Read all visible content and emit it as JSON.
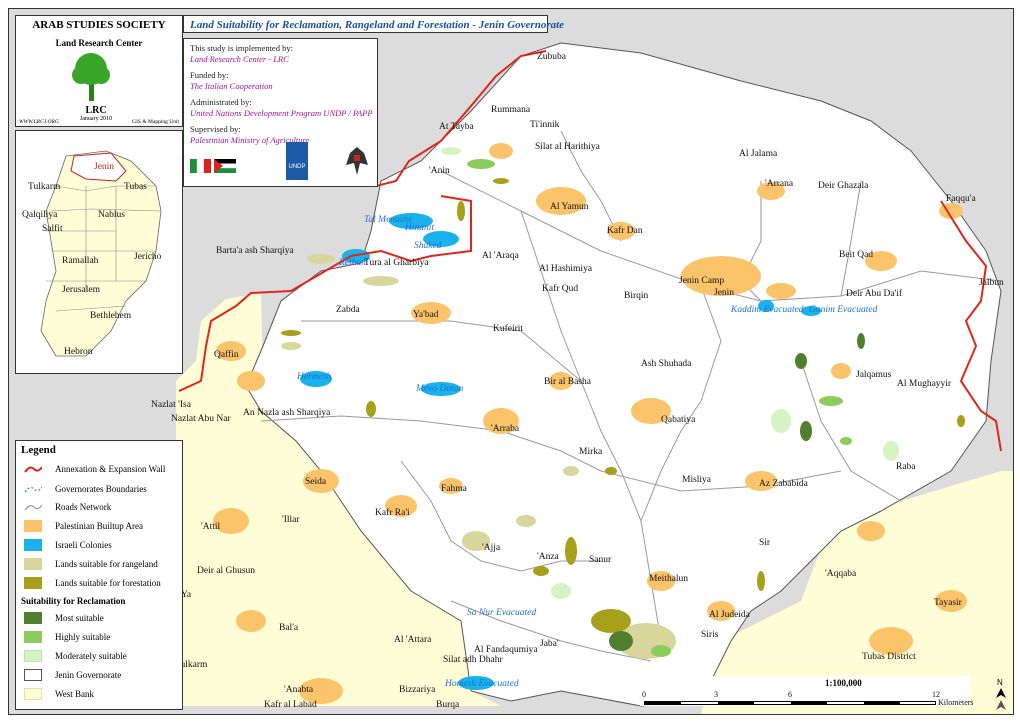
{
  "header": {
    "organization": "ARAB STUDIES SOCIETY",
    "department": "Land Research Center",
    "logo_text": "LRC",
    "date": "January 2010",
    "website": "WWW.LRCJ.ORG",
    "unit": "GIS & Mapping Unit"
  },
  "map_title": "Land Suitability for Reclamation, Rangeland and Forestation  - Jenin  Governorate",
  "credits": {
    "implemented_label": "This study is implemented by:",
    "implemented_value": "Land Research Center - LRC",
    "funded_label": "Funded by:",
    "funded_value": "The Italian Cooperation",
    "administered_label": "Administrated by:",
    "administered_value": "United Nations Development Program UNDP / PAPP",
    "supervised_label": "Supervised by:",
    "supervised_value": "Palestinian Ministry of Agriculture",
    "undp_logo": "UNDP"
  },
  "inset_map": {
    "highlight": "Jenin",
    "governorates": [
      "Tulkarm",
      "Tubas",
      "Qalqiliya",
      "Nablus",
      "Salfit",
      "Ramallah",
      "Jericho",
      "Jerusalem",
      "Bethlehem",
      "Hebron"
    ]
  },
  "legend": {
    "title": "Legend",
    "items": [
      {
        "label": "Annexation & Expansion Wall",
        "kind": "line",
        "color": "#e0261b"
      },
      {
        "label": "Governorates Boundaries",
        "kind": "dash",
        "color": "#2f7fd6"
      },
      {
        "label": "Roads Network",
        "kind": "line",
        "color": "#9a9a9a"
      },
      {
        "label": "Palestinian Builtup Area",
        "kind": "fill",
        "color": "#fbc36a"
      },
      {
        "label": "Israeli Colonies",
        "kind": "fill",
        "color": "#1ab2ea"
      },
      {
        "label": "Lands suitable for rangeland",
        "kind": "fill",
        "color": "#d8d69c"
      },
      {
        "label": "Lands suitable for forestation",
        "kind": "fill",
        "color": "#a6a01a"
      }
    ],
    "reclamation_title": "Suitability for Reclamation",
    "reclamation_items": [
      {
        "label": "Most suitable",
        "color": "#4f7f2f"
      },
      {
        "label": "Highly suitable",
        "color": "#8ccc5c"
      },
      {
        "label": "Moderately suitable",
        "color": "#d4f4c4"
      },
      {
        "label": "Jenin Governorate",
        "color": "#ffffff"
      },
      {
        "label": "West Bank",
        "color": "#fffdd6"
      }
    ]
  },
  "scale": {
    "ratio": "1:100,000",
    "ticks": [
      "0",
      "3",
      "6",
      "12"
    ],
    "unit": "Kilometers"
  },
  "places": [
    {
      "name": "Zububa"
    },
    {
      "name": "Rummana"
    },
    {
      "name": "Ti'innik"
    },
    {
      "name": "At Tayba"
    },
    {
      "name": "Silat al Harithiya"
    },
    {
      "name": "Al Jalama"
    },
    {
      "name": "'Anin"
    },
    {
      "name": "'Arrana"
    },
    {
      "name": "Deir Ghazala"
    },
    {
      "name": "Faqqu'a"
    },
    {
      "name": "Al Yamun"
    },
    {
      "name": "Kafr Dan"
    },
    {
      "name": "Tal Menashe"
    },
    {
      "name": "Hinanit"
    },
    {
      "name": "Shaked"
    },
    {
      "name": "Barta'a ash Sharqiya"
    },
    {
      "name": "Reihan"
    },
    {
      "name": "Tura al Gharbiya"
    },
    {
      "name": "Al 'Araqa"
    },
    {
      "name": "Beit Qad"
    },
    {
      "name": "Al Hashimiya"
    },
    {
      "name": "Jenin Camp"
    },
    {
      "name": "Jenin"
    },
    {
      "name": "Jalbun"
    },
    {
      "name": "Kafr Qud"
    },
    {
      "name": "Birqin"
    },
    {
      "name": "Deir Abu Da'if"
    },
    {
      "name": "Zabda"
    },
    {
      "name": "Ya'bad"
    },
    {
      "name": "Kaddim Evacuated"
    },
    {
      "name": "Ganim Evacuated"
    },
    {
      "name": "Kufeirit"
    },
    {
      "name": "Qaffin"
    },
    {
      "name": "Ash Shuhada"
    },
    {
      "name": "Jalqamus"
    },
    {
      "name": "Mevo Dotan"
    },
    {
      "name": "Bir al Basha"
    },
    {
      "name": "Hermesh"
    },
    {
      "name": "Al Mughayyir"
    },
    {
      "name": "Nazlat 'Isa"
    },
    {
      "name": "Nazlat Abu Nar"
    },
    {
      "name": "An Nazla ash Sharqiya"
    },
    {
      "name": "Qabatiya"
    },
    {
      "name": "'Arraba"
    },
    {
      "name": "Mirka"
    },
    {
      "name": "Raba"
    },
    {
      "name": "Misliya"
    },
    {
      "name": "Az Zababida"
    },
    {
      "name": "Seida"
    },
    {
      "name": "Fahma"
    },
    {
      "name": "Kafr Ra'i"
    },
    {
      "name": "'Attil"
    },
    {
      "name": "'Illar"
    },
    {
      "name": "Sir"
    },
    {
      "name": "'Ajja"
    },
    {
      "name": "'Anza"
    },
    {
      "name": "Sanur"
    },
    {
      "name": "Deir al Ghusun"
    },
    {
      "name": "Meithalun"
    },
    {
      "name": "'Aqqaba"
    },
    {
      "name": "Tayasir"
    },
    {
      "name": "Sa Nur Evacuated"
    },
    {
      "name": "Al Judeida"
    },
    {
      "name": "Siris"
    },
    {
      "name": "Bal'a"
    },
    {
      "name": "Al 'Attara"
    },
    {
      "name": "Jaba'"
    },
    {
      "name": "Al Fandaqumiya"
    },
    {
      "name": "Silat adh Dhahr"
    },
    {
      "name": "Tubas District"
    },
    {
      "name": "Tulkarm"
    },
    {
      "name": "'Anabta"
    },
    {
      "name": "Bizzariya"
    },
    {
      "name": "Homesh Evacuated"
    },
    {
      "name": "Kafr al Labad"
    },
    {
      "name": "Burqa"
    },
    {
      "name": "Ya"
    }
  ],
  "colors": {
    "outside": "#dcdcdc",
    "governorate": "#ffffff",
    "westbank": "#fffdd6",
    "builtup": "#fbc36a",
    "colony": "#1ab2ea",
    "wall": "#e0261b",
    "road": "#9a9a9a"
  }
}
